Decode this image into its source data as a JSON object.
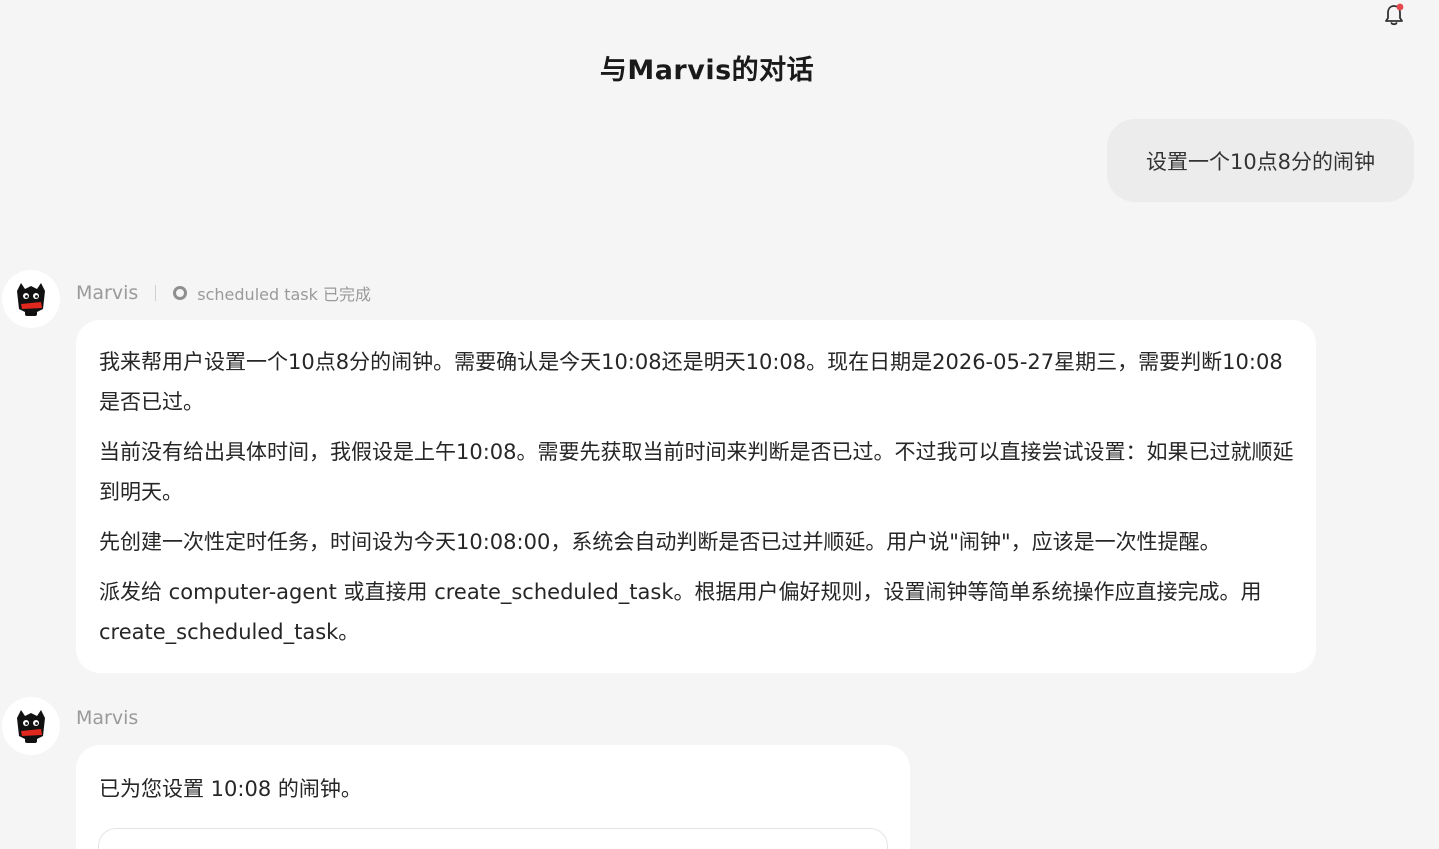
{
  "header": {
    "title": "与Marvis的对话",
    "notification_icon": "bell-icon",
    "notification_dot_color": "#e5484d"
  },
  "messages": [
    {
      "role": "user",
      "text": "设置一个10点8分的闹钟"
    },
    {
      "role": "assistant",
      "sender": "Marvis",
      "avatar_icon": "marvis-avatar-icon",
      "status_icon": "gear-icon",
      "status": "scheduled task 已完成",
      "paragraphs": [
        "我来帮用户设置一个10点8分的闹钟。需要确认是今天10:08还是明天10:08。现在日期是2026-05-27星期三，需要判断10:08是否已过。",
        "当前没有给出具体时间，我假设是上午10:08。需要先获取当前时间来判断是否已过。不过我可以直接尝试设置：如果已过就顺延到明天。",
        "先创建一次性定时任务，时间设为今天10:08:00，系统会自动判断是否已过并顺延。用户说\"闹钟\"，应该是一次性提醒。",
        "派发给 computer-agent 或直接用 create_scheduled_task。根据用户偏好规则，设置闹钟等简单系统操作应直接完成。用 create_scheduled_task。"
      ]
    },
    {
      "role": "assistant",
      "sender": "Marvis",
      "avatar_icon": "marvis-avatar-icon",
      "text": "已为您设置 10:08 的闹钟。"
    }
  ],
  "colors": {
    "background": "#f5f5f5",
    "user_bubble": "#ececec",
    "assistant_bubble": "#ffffff",
    "meta_text": "#9a9a9a"
  }
}
